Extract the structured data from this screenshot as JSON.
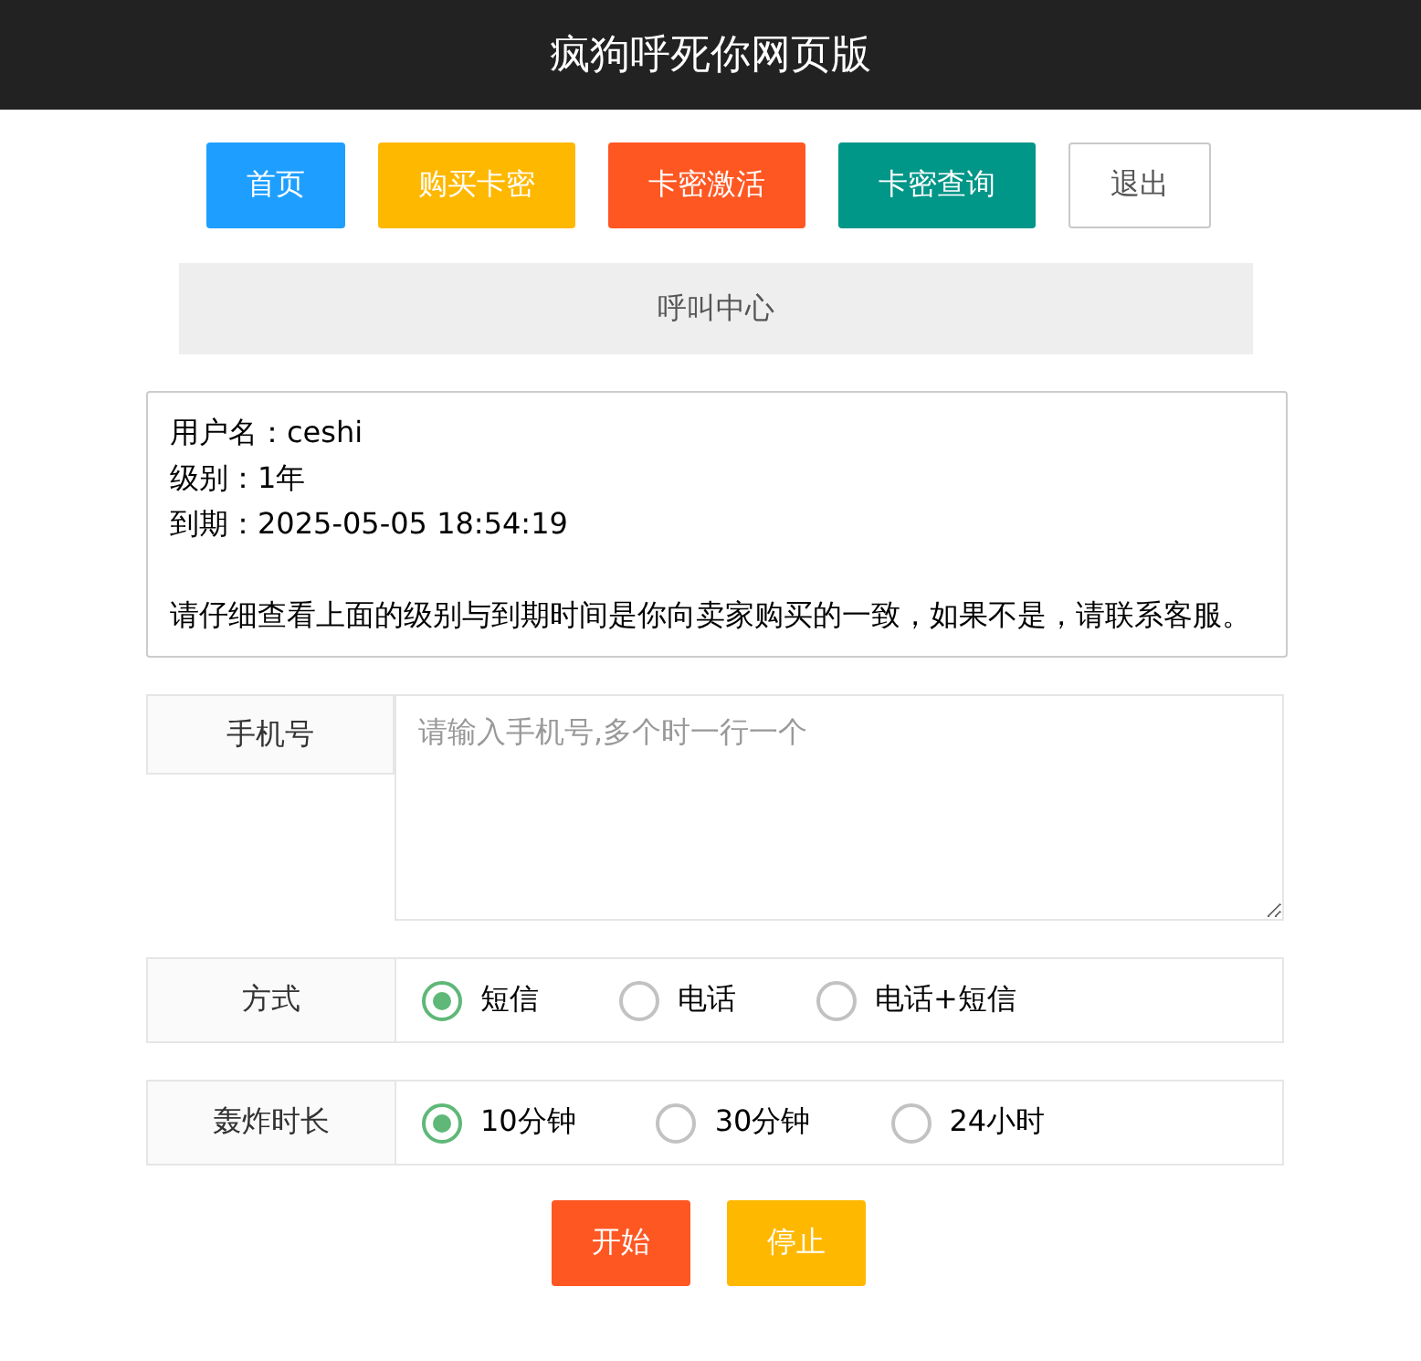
{
  "header": {
    "title": "疯狗呼死你网页版"
  },
  "nav_buttons": [
    {
      "label": "首页",
      "kind": "filled",
      "color": "#1e9fff"
    },
    {
      "label": "购买卡密",
      "kind": "filled",
      "color": "#ffb800"
    },
    {
      "label": "卡密激活",
      "kind": "filled",
      "color": "#ff5722"
    },
    {
      "label": "卡密查询",
      "kind": "filled",
      "color": "#009688"
    },
    {
      "label": "退出",
      "kind": "outline",
      "color": "#ffffff"
    }
  ],
  "section_title": "呼叫中心",
  "info": {
    "lines": [
      "用户名：ceshi",
      "级别：1年",
      "到期：2025-05-05 18:54:19"
    ],
    "notice": "请仔细查看上面的级别与到期时间是你向卖家购买的一致，如果不是，请联系客服。"
  },
  "phone": {
    "label": "手机号",
    "placeholder": "请输入手机号,多个时一行一个"
  },
  "radio_groups": [
    {
      "label": "方式",
      "options": [
        {
          "label": "短信",
          "selected": true
        },
        {
          "label": "电话",
          "selected": false
        },
        {
          "label": "电话+短信",
          "selected": false
        }
      ]
    },
    {
      "label": "轰炸时长",
      "options": [
        {
          "label": "10分钟",
          "selected": true
        },
        {
          "label": "30分钟",
          "selected": false
        },
        {
          "label": "24小时",
          "selected": false
        }
      ]
    }
  ],
  "actions": [
    {
      "label": "开始",
      "color": "#ff5722"
    },
    {
      "label": "停止",
      "color": "#ffb800"
    }
  ]
}
